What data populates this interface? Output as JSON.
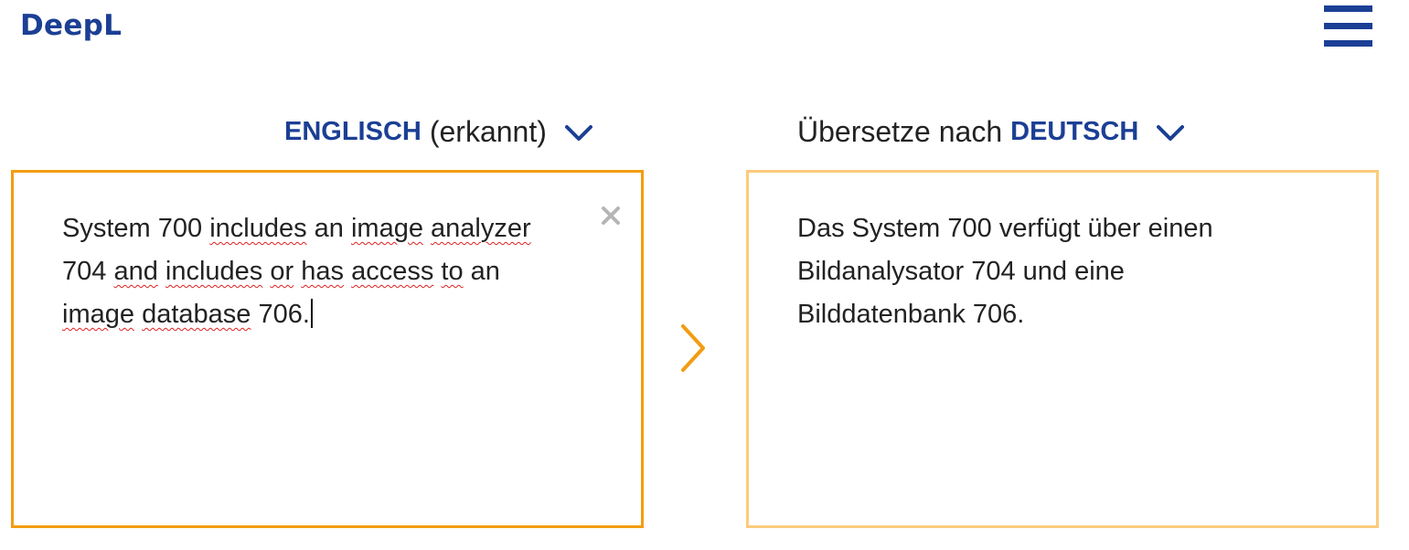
{
  "header": {
    "logo": "DeepL",
    "menu_icon": "hamburger-menu-icon"
  },
  "source_lang": {
    "name": "ENGLISCH",
    "note": "(erkannt)",
    "dropdown_icon": "chevron-down-icon"
  },
  "target_lang": {
    "prefix": "Übersetze nach",
    "name": "DEUTSCH",
    "dropdown_icon": "chevron-down-icon"
  },
  "source": {
    "line1": [
      "System 700 ",
      "includes",
      " an ",
      "image",
      " ",
      "analyzer"
    ],
    "line2": [
      "704 ",
      "and",
      " ",
      "includes",
      " ",
      "or",
      " ",
      "has",
      " ",
      "access",
      " ",
      "to",
      " an"
    ],
    "line3": [
      "image",
      " ",
      "database",
      " 706."
    ],
    "clear_icon": "close-icon"
  },
  "target": {
    "line1": "Das System 700 verfügt über einen",
    "line2": "Bildanalysator 704 und eine",
    "line3": "Bilddatenbank 706."
  },
  "translate_arrow_icon": "chevron-right-icon",
  "colors": {
    "brand_blue": "#1b3f94",
    "source_border": "#f39c12",
    "target_border": "#fbcb7c",
    "arrow": "#f39c12",
    "spellcheck": "#e02020"
  }
}
